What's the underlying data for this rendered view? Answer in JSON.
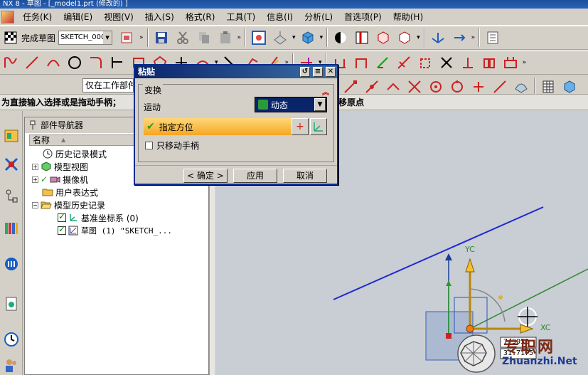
{
  "app": {
    "title": "NX 8 - 草图 - [_model1.prt (修改的) ]"
  },
  "menu": [
    "任务(K)",
    "编辑(E)",
    "视图(V)",
    "插入(S)",
    "格式(R)",
    "工具(T)",
    "信息(I)",
    "分析(L)",
    "首选项(P)",
    "帮助(H)"
  ],
  "sketch_bar": {
    "finish_label": "完成草图",
    "sketch_name": "SKETCH_000"
  },
  "selection": {
    "scope": "仅在工作部件"
  },
  "cue": {
    "left": "为直接输入选择或是拖动手柄；",
    "right": "移原点"
  },
  "navigator": {
    "title": "部件导航器",
    "column": "名称",
    "items": [
      {
        "label": "历史记录模式"
      },
      {
        "label": "模型视图"
      },
      {
        "label": "摄像机"
      },
      {
        "label": "用户表达式"
      },
      {
        "label": "模型历史记录"
      },
      {
        "label": "基准坐标系 (0)"
      },
      {
        "label": "草图 (1) \"SKETCH_..."
      }
    ]
  },
  "dialog": {
    "title": "粘贴",
    "group": "变换",
    "motion_label": "运动",
    "motion_value": "动态",
    "orient_label": "指定方位",
    "only_handle": "只移动手柄",
    "ok": "< 确定 >",
    "apply": "应用",
    "cancel": "取消"
  },
  "graphics": {
    "yc": "YC",
    "xc": "XC",
    "coord1": "7.9030",
    "coord2": "31.7175"
  },
  "watermark": {
    "text": "专职网",
    "url": "Zhuanzhi.Net"
  }
}
